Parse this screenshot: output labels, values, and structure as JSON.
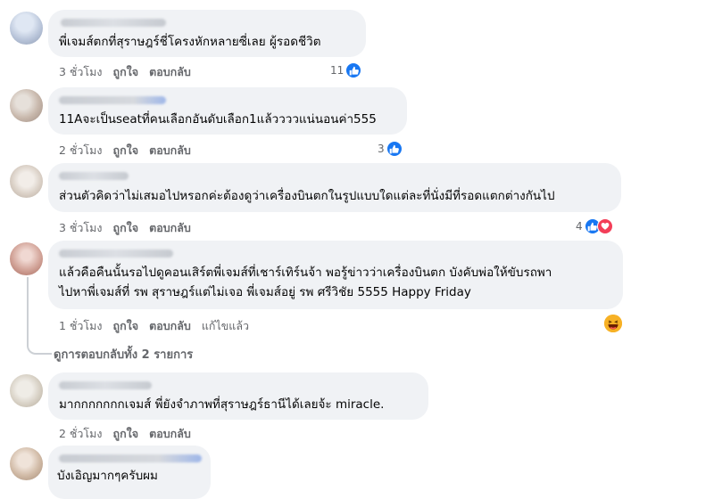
{
  "comments": [
    {
      "text": "พี่เจมส์ตกที่สุราษฎร์ชี่โครงหักหลายซี่เลย ผู้รอดชีวิต",
      "time": "3 ชั่วโมง",
      "like": "ถูกใจ",
      "reply": "ตอบกลับ",
      "reaction_count": "11",
      "reactions": [
        "like"
      ]
    },
    {
      "text": "11Aจะเป็นseatที่คนเลือกอันดับเลือก1แล้ววววแน่นอนค่า555",
      "time": "2 ชั่วโมง",
      "like": "ถูกใจ",
      "reply": "ตอบกลับ",
      "reaction_count": "3",
      "reactions": [
        "like"
      ]
    },
    {
      "text": "ส่วนตัวคิดว่าไม่เสมอไปหรอกค่ะต้องดูว่าเครื่องบินตกในรูปแบบใดแต่ละที่นั่งมีที่รอดแตกต่างกันไป",
      "time": "3 ชั่วโมง",
      "like": "ถูกใจ",
      "reply": "ตอบกลับ",
      "reaction_count": "4",
      "reactions": [
        "like",
        "love"
      ]
    },
    {
      "text_line1": "แล้วคือคืนนั้นรอไปดูคอนเสิร์ตพี่เจมส์ที่เชาร์เทิร์นจ้า พอรู้ข่าวว่าเครื่องบินตก บังคับพ่อให้ขับรถพา",
      "text_line2": "ไปหาพี่เจมส์ที่ รพ สุราษฎร์แต่ไม่เจอ พี่เจมส์อยู่ รพ ศรีวิชัย 5555 Happy Friday",
      "time": "1 ชั่วโมง",
      "like": "ถูกใจ",
      "reply": "ตอบกลับ",
      "edited": "แก้ไขแล้ว",
      "reactions": [
        "haha"
      ]
    },
    {
      "text": "มากกกกกกกเจมส์ พี่ยังจำภาพที่สุราษฎร์ธานีได้เลยจ้ะ miracle.",
      "time": "2 ชั่วโมง",
      "like": "ถูกใจ",
      "reply": "ตอบกลับ"
    },
    {
      "text": "บังเอิญมากๆครับผม"
    }
  ],
  "view_replies": "ดูการตอบกลับทั้ง 2 รายการ",
  "colors": {
    "like": "#1877f2",
    "love": "#f33e58",
    "haha": "#f7b125",
    "bubble": "#f0f2f5",
    "meta": "#65676b"
  }
}
